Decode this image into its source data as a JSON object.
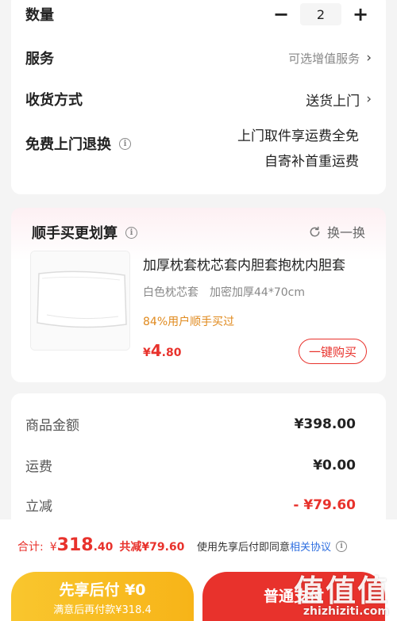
{
  "quantity": {
    "label": "数量",
    "minus": "−",
    "value": "2",
    "plus": "+"
  },
  "service": {
    "label": "服务",
    "value": "可选增值服务",
    "chevron": "›"
  },
  "delivery": {
    "label": "收货方式",
    "value": "送货上门",
    "chevron": "›"
  },
  "returns": {
    "label": "免费上门退换",
    "info_icon": "i",
    "line1": "上门取件享运费全免",
    "line2": "自寄补首重运费"
  },
  "addon": {
    "title": "顺手买更划算",
    "info_icon": "i",
    "swap_label": "换一换",
    "product": {
      "title": "加厚枕套枕芯套内胆套抱枕内胆套",
      "spec_color": "白色枕芯套",
      "spec_size": "加密加厚44*70cm",
      "buyers": "84%用户顺手买过",
      "currency": "¥",
      "price_int": "4",
      "price_dec": ".80",
      "buy_button": "一键购买"
    }
  },
  "fees": {
    "rows": [
      {
        "label": "商品金额",
        "value": "¥398.00"
      },
      {
        "label": "运费",
        "value": "¥0.00"
      },
      {
        "label": "立减",
        "value": "- ¥79.60"
      }
    ]
  },
  "bottom": {
    "total_label": "合计:",
    "currency": "¥",
    "total_int": "318",
    "total_dec": ".40",
    "saved": "共减¥79.60",
    "agree_prefix": "使用先享后付即同意",
    "agree_link": "相关协议",
    "pay_later_main": "先享后付 ¥0",
    "pay_later_sub": "满意后再付款¥318.4",
    "pay_normal": "普通支付"
  },
  "watermark": {
    "main": "值值值",
    "sub": "zhizhiziti.com"
  },
  "colors": {
    "accent_red": "#e8322c",
    "accent_orange": "#e08a1e",
    "pay_later_yellow": "#f7b418",
    "link_blue": "#2f6fe0"
  }
}
